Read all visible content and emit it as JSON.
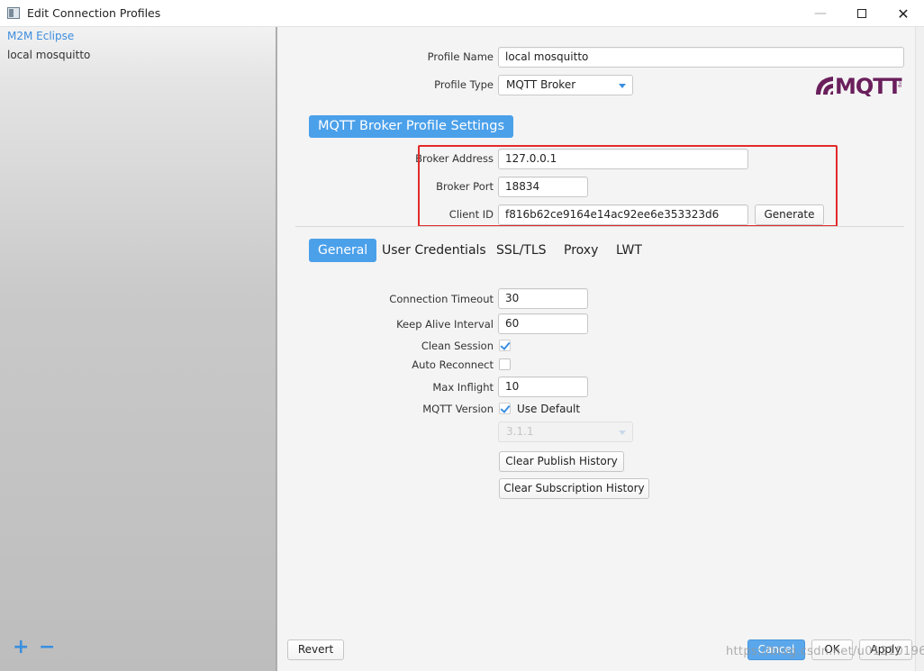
{
  "window": {
    "title": "Edit Connection Profiles"
  },
  "sidebar": {
    "items": [
      {
        "label": "M2M Eclipse"
      },
      {
        "label": "local mosquitto"
      }
    ],
    "add_label": "+",
    "remove_label": "−"
  },
  "profile": {
    "name_label": "Profile Name",
    "name_value": "local mosquitto",
    "type_label": "Profile Type",
    "type_value": "MQTT Broker",
    "logo_text": "MQTT",
    "logo_sub": ".org"
  },
  "broker": {
    "section_title": "MQTT Broker Profile Settings",
    "address_label": "Broker Address",
    "address_value": "127.0.0.1",
    "port_label": "Broker Port",
    "port_value": "18834",
    "client_id_label": "Client ID",
    "client_id_value": "f816b62ce9164e14ac92ee6e353323d6",
    "generate_label": "Generate"
  },
  "tabs": [
    {
      "label": "General",
      "active": true
    },
    {
      "label": "User Credentials",
      "active": false
    },
    {
      "label": "SSL/TLS",
      "active": false
    },
    {
      "label": "Proxy",
      "active": false
    },
    {
      "label": "LWT",
      "active": false
    }
  ],
  "general": {
    "connection_timeout_label": "Connection Timeout",
    "connection_timeout_value": "30",
    "keep_alive_label": "Keep Alive Interval",
    "keep_alive_value": "60",
    "clean_session_label": "Clean Session",
    "clean_session_checked": true,
    "auto_reconnect_label": "Auto Reconnect",
    "auto_reconnect_checked": false,
    "max_inflight_label": "Max Inflight",
    "max_inflight_value": "10",
    "mqtt_version_label": "MQTT Version",
    "use_default_label": "Use Default",
    "use_default_checked": true,
    "version_value": "3.1.1",
    "clear_publish_label": "Clear Publish History",
    "clear_subscription_label": "Clear Subscription History"
  },
  "footer": {
    "revert_label": "Revert",
    "cancel_label": "Cancel",
    "ok_label": "OK",
    "apply_label": "Apply"
  },
  "watermark": "https://blog.csdn.net/u012101961",
  "colors": {
    "accent": "#4ba0ea",
    "highlight": "#e22a2a",
    "logo": "#6a1f5c"
  }
}
